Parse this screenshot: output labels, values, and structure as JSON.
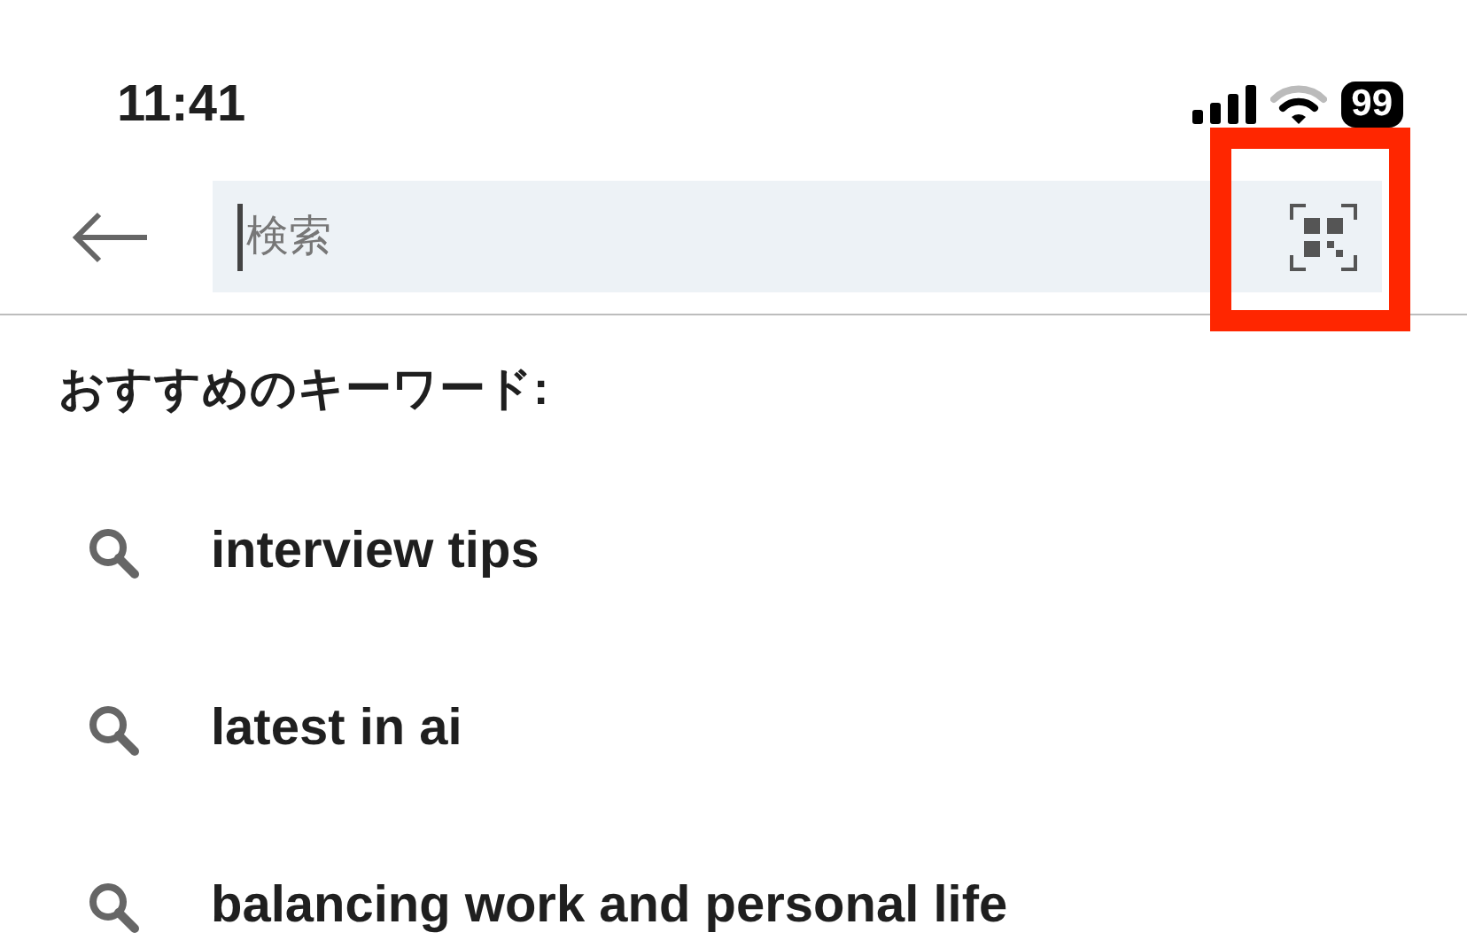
{
  "status_bar": {
    "time": "11:41",
    "battery": "99"
  },
  "search": {
    "placeholder": "検索",
    "focused": true
  },
  "scan_button": {
    "highlighted": true
  },
  "suggestions": {
    "heading": "おすすめのキーワード:",
    "items": [
      {
        "text": "interview tips"
      },
      {
        "text": "latest in ai"
      },
      {
        "text": "balancing work and personal life"
      }
    ]
  }
}
